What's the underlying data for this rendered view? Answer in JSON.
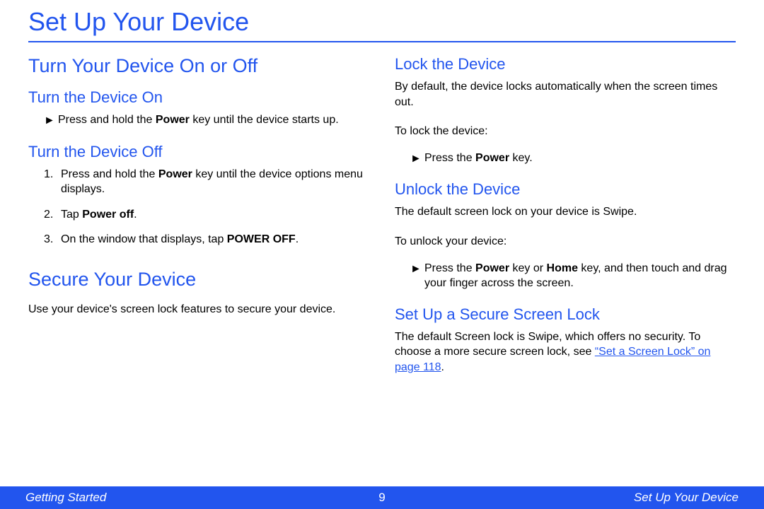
{
  "title": "Set Up Your Device",
  "left": {
    "h1_turn": "Turn Your Device On or Off",
    "h2_on": "Turn the Device On",
    "on_step_pre": "Press and hold the ",
    "on_step_bold": "Power",
    "on_step_post": " key until the device starts up.",
    "h2_off": "Turn the Device Off",
    "off1_pre": "Press and hold the ",
    "off1_bold": "Power",
    "off1_post": " key until the device options menu displays.",
    "off2_pre": "Tap ",
    "off2_bold": "Power off",
    "off2_post": ".",
    "off3_pre": "On the window that displays, tap ",
    "off3_bold": "POWER OFF",
    "off3_post": ".",
    "h1_secure": "Secure Your Device",
    "secure_intro": "Use your device's screen lock features to secure your device."
  },
  "right": {
    "h2_lock": "Lock the Device",
    "lock_intro": "By default, the device locks automatically when the screen times out.",
    "lock_label": "To lock the device:",
    "lock_step_pre": "Press the ",
    "lock_step_bold": "Power",
    "lock_step_post": " key.",
    "h2_unlock": "Unlock the Device",
    "unlock_intro": "The default screen lock on your device is Swipe.",
    "unlock_label": "To unlock your device:",
    "unlock_step_pre": "Press the ",
    "unlock_step_b1": "Power",
    "unlock_step_mid": " key or ",
    "unlock_step_b2": "Home",
    "unlock_step_post": " key, and then touch and drag your finger across the screen.",
    "h2_setup": "Set Up a Secure Screen Lock",
    "setup_text": "The default Screen lock is Swipe, which offers no security. To choose a more secure screen lock, see ",
    "setup_xref": "“Set a Screen Lock” on page 118",
    "setup_post": "."
  },
  "footer": {
    "left": "Getting Started",
    "page": "9",
    "right": "Set Up Your Device"
  },
  "glyph": {
    "arrow": "►"
  }
}
